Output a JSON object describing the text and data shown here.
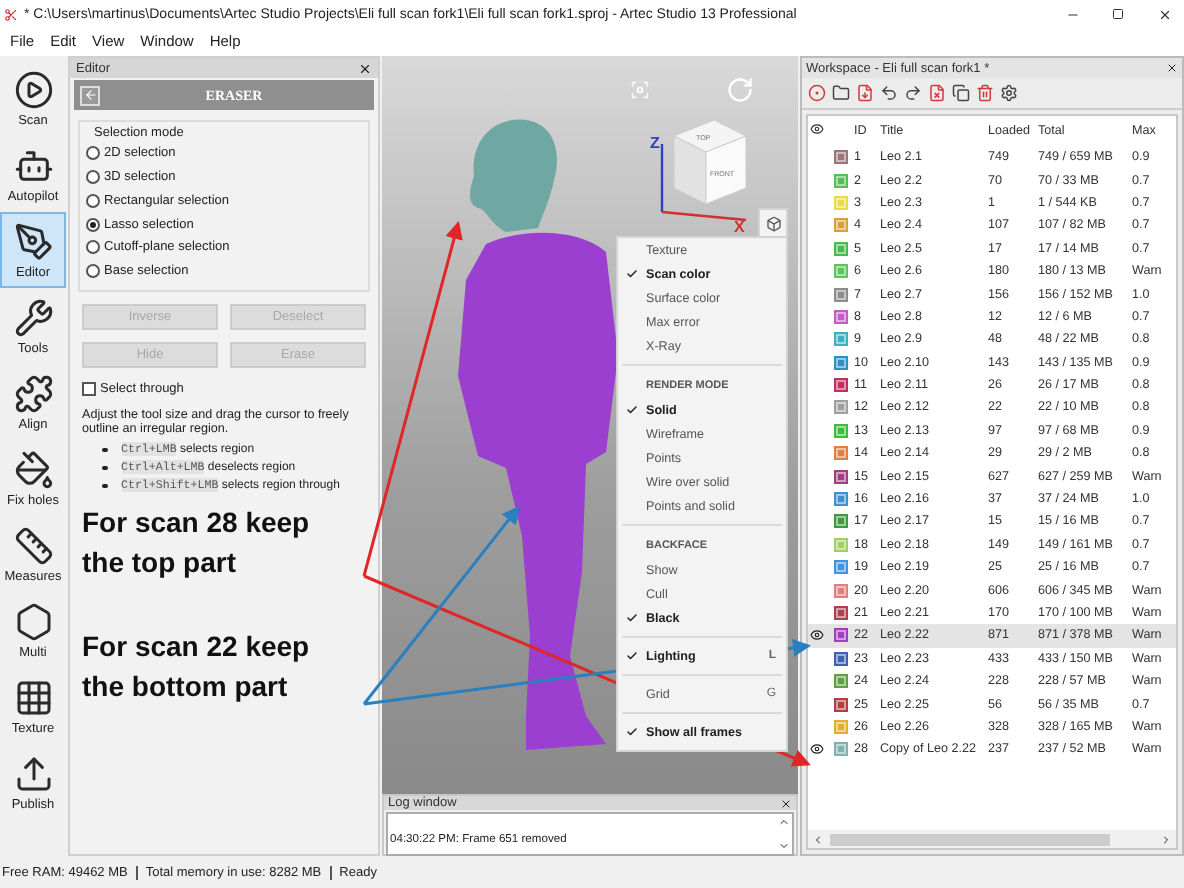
{
  "window": {
    "title": "* C:\\Users\\martinus\\Documents\\Artec Studio Projects\\Eli full scan fork1\\Eli full scan fork1.sproj - Artec Studio 13 Professional"
  },
  "menu": [
    "File",
    "Edit",
    "View",
    "Window",
    "Help"
  ],
  "toolbar": [
    {
      "label": "Scan",
      "selected": false
    },
    {
      "label": "Autopilot",
      "selected": false
    },
    {
      "label": "Editor",
      "selected": true
    },
    {
      "label": "Tools",
      "selected": false
    },
    {
      "label": "Align",
      "selected": false
    },
    {
      "label": "Fix holes",
      "selected": false
    },
    {
      "label": "Measures",
      "selected": false
    },
    {
      "label": "Multi",
      "selected": false
    },
    {
      "label": "Texture",
      "selected": false
    },
    {
      "label": "Publish",
      "selected": false
    }
  ],
  "editor": {
    "title": "Editor",
    "tool": "ERASER",
    "selection_mode": {
      "label": "Selection mode",
      "options": [
        {
          "label": "2D selection",
          "selected": false
        },
        {
          "label": "3D selection",
          "selected": false
        },
        {
          "label": "Rectangular selection",
          "selected": false
        },
        {
          "label": "Lasso selection",
          "selected": true
        },
        {
          "label": "Cutoff-plane selection",
          "selected": false
        },
        {
          "label": "Base selection",
          "selected": false
        }
      ]
    },
    "buttons": [
      {
        "label": "Inverse",
        "disabled": true
      },
      {
        "label": "Deselect",
        "disabled": true
      },
      {
        "label": "Hide",
        "disabled": true
      },
      {
        "label": "Erase",
        "disabled": true
      }
    ],
    "select_through": {
      "label": "Select through",
      "checked": false
    },
    "description": "Adjust the tool size and drag the cursor to freely outline an irregular region.",
    "shortcuts": [
      {
        "keys": "Ctrl+LMB",
        "text": "selects region"
      },
      {
        "keys": "Ctrl+Alt+LMB",
        "text": "deselects region"
      },
      {
        "keys": "Ctrl+Shift+LMB",
        "text": "selects region through"
      }
    ]
  },
  "annotations": [
    {
      "text": "For scan 28 keep the top part",
      "color": "#e02626"
    },
    {
      "text": "For scan 22 keep the bottom part",
      "color": "#2a7fc0"
    }
  ],
  "viewport": {
    "cube": {
      "top": "TOP",
      "front": "FRONT"
    },
    "axes": [
      "Z",
      "X"
    ],
    "render_menu": [
      {
        "kind": "item",
        "label": "Texture",
        "checked": false
      },
      {
        "kind": "item",
        "label": "Scan color",
        "checked": true
      },
      {
        "kind": "item",
        "label": "Surface color",
        "checked": false
      },
      {
        "kind": "item",
        "label": "Max error",
        "checked": false
      },
      {
        "kind": "item",
        "label": "X-Ray",
        "checked": false
      },
      {
        "kind": "separator"
      },
      {
        "kind": "header",
        "label": "RENDER MODE"
      },
      {
        "kind": "item",
        "label": "Solid",
        "checked": true
      },
      {
        "kind": "item",
        "label": "Wireframe",
        "checked": false
      },
      {
        "kind": "item",
        "label": "Points",
        "checked": false
      },
      {
        "kind": "item",
        "label": "Wire over solid",
        "checked": false
      },
      {
        "kind": "item",
        "label": "Points and solid",
        "checked": false
      },
      {
        "kind": "separator"
      },
      {
        "kind": "header",
        "label": "BACKFACE"
      },
      {
        "kind": "item",
        "label": "Show",
        "checked": false
      },
      {
        "kind": "item",
        "label": "Cull",
        "checked": false
      },
      {
        "kind": "item",
        "label": "Black",
        "checked": true
      },
      {
        "kind": "separator"
      },
      {
        "kind": "item",
        "label": "Lighting",
        "checked": true,
        "shortcut": "L"
      },
      {
        "kind": "separator"
      },
      {
        "kind": "item",
        "label": "Grid",
        "checked": false,
        "shortcut": "G"
      },
      {
        "kind": "separator"
      },
      {
        "kind": "item",
        "label": "Show all frames",
        "checked": true
      }
    ]
  },
  "log": {
    "title": "Log window",
    "entries": [
      "04:30:22 PM: Frame 651 removed"
    ]
  },
  "workspace": {
    "title": "Workspace - Eli full scan fork1 *",
    "columns": [
      "ID",
      "Title",
      "Loaded",
      "Total",
      "Max"
    ],
    "rows": [
      {
        "id": "1",
        "title": "Leo 2.1",
        "loaded": "749",
        "total": "749 / 659 MB",
        "max": "0.9",
        "color": "#9a7676",
        "visible": false,
        "selected": false
      },
      {
        "id": "2",
        "title": "Leo 2.2",
        "loaded": "70",
        "total": "70 / 33 MB",
        "max": "0.7",
        "color": "#52c052",
        "visible": false,
        "selected": false
      },
      {
        "id": "3",
        "title": "Leo 2.3",
        "loaded": "1",
        "total": "1 / 544 KB",
        "max": "0.7",
        "color": "#e6dc4a",
        "visible": false,
        "selected": false
      },
      {
        "id": "4",
        "title": "Leo 2.4",
        "loaded": "107",
        "total": "107 / 82 MB",
        "max": "0.7",
        "color": "#d8a040",
        "visible": false,
        "selected": false
      },
      {
        "id": "5",
        "title": "Leo 2.5",
        "loaded": "17",
        "total": "17 / 14 MB",
        "max": "0.7",
        "color": "#48bc48",
        "visible": false,
        "selected": false
      },
      {
        "id": "6",
        "title": "Leo 2.6",
        "loaded": "180",
        "total": "180 / 13 MB",
        "max": "Warn",
        "color": "#5cc45c",
        "visible": false,
        "selected": false
      },
      {
        "id": "7",
        "title": "Leo 2.7",
        "loaded": "156",
        "total": "156 / 152 MB",
        "max": "1.0",
        "color": "#8c8c8c",
        "visible": false,
        "selected": false
      },
      {
        "id": "8",
        "title": "Leo 2.8",
        "loaded": "12",
        "total": "12 / 6 MB",
        "max": "0.7",
        "color": "#c45cc4",
        "visible": false,
        "selected": false
      },
      {
        "id": "9",
        "title": "Leo 2.9",
        "loaded": "48",
        "total": "48 / 22 MB",
        "max": "0.8",
        "color": "#3eb0c0",
        "visible": false,
        "selected": false
      },
      {
        "id": "10",
        "title": "Leo 2.10",
        "loaded": "143",
        "total": "143 / 135 MB",
        "max": "0.9",
        "color": "#2e90c0",
        "visible": false,
        "selected": false
      },
      {
        "id": "11",
        "title": "Leo 2.11",
        "loaded": "26",
        "total": "26 / 17 MB",
        "max": "0.8",
        "color": "#c0305e",
        "visible": false,
        "selected": false
      },
      {
        "id": "12",
        "title": "Leo 2.12",
        "loaded": "22",
        "total": "22 / 10 MB",
        "max": "0.8",
        "color": "#a0a0a0",
        "visible": false,
        "selected": false
      },
      {
        "id": "13",
        "title": "Leo 2.13",
        "loaded": "97",
        "total": "97 / 68 MB",
        "max": "0.9",
        "color": "#3cbc3c",
        "visible": false,
        "selected": false
      },
      {
        "id": "14",
        "title": "Leo 2.14",
        "loaded": "29",
        "total": "29 / 2 MB",
        "max": "0.8",
        "color": "#e08040",
        "visible": false,
        "selected": false
      },
      {
        "id": "15",
        "title": "Leo 2.15",
        "loaded": "627",
        "total": "627 / 259 MB",
        "max": "Warn",
        "color": "#a04080",
        "visible": false,
        "selected": false
      },
      {
        "id": "16",
        "title": "Leo 2.16",
        "loaded": "37",
        "total": "37 / 24 MB",
        "max": "1.0",
        "color": "#4090d0",
        "visible": false,
        "selected": false
      },
      {
        "id": "17",
        "title": "Leo 2.17",
        "loaded": "15",
        "total": "15 / 16 MB",
        "max": "0.7",
        "color": "#3c9c3c",
        "visible": false,
        "selected": false
      },
      {
        "id": "18",
        "title": "Leo 2.18",
        "loaded": "149",
        "total": "149 / 161 MB",
        "max": "0.7",
        "color": "#a0d060",
        "visible": false,
        "selected": false
      },
      {
        "id": "19",
        "title": "Leo 2.19",
        "loaded": "25",
        "total": "25 / 16 MB",
        "max": "0.7",
        "color": "#4492e0",
        "visible": false,
        "selected": false
      },
      {
        "id": "20",
        "title": "Leo 2.20",
        "loaded": "606",
        "total": "606 / 345 MB",
        "max": "Warn",
        "color": "#e08080",
        "visible": false,
        "selected": false
      },
      {
        "id": "21",
        "title": "Leo 2.21",
        "loaded": "170",
        "total": "170 / 100 MB",
        "max": "Warn",
        "color": "#b04050",
        "visible": false,
        "selected": false
      },
      {
        "id": "22",
        "title": "Leo 2.22",
        "loaded": "871",
        "total": "871 / 378 MB",
        "max": "Warn",
        "color": "#a040c0",
        "visible": true,
        "selected": true
      },
      {
        "id": "23",
        "title": "Leo 2.23",
        "loaded": "433",
        "total": "433 / 150 MB",
        "max": "Warn",
        "color": "#4060b0",
        "visible": false,
        "selected": false
      },
      {
        "id": "24",
        "title": "Leo 2.24",
        "loaded": "228",
        "total": "228 / 57 MB",
        "max": "Warn",
        "color": "#60a040",
        "visible": false,
        "selected": false
      },
      {
        "id": "25",
        "title": "Leo 2.25",
        "loaded": "56",
        "total": "56 / 35 MB",
        "max": "0.7",
        "color": "#b04040",
        "visible": false,
        "selected": false
      },
      {
        "id": "26",
        "title": "Leo 2.26",
        "loaded": "328",
        "total": "328 / 165 MB",
        "max": "Warn",
        "color": "#e0b030",
        "visible": false,
        "selected": false
      },
      {
        "id": "28",
        "title": "Copy of Leo 2.22",
        "loaded": "237",
        "total": "237 / 52 MB",
        "max": "Warn",
        "color": "#80b0b0",
        "visible": true,
        "selected": false
      }
    ]
  },
  "status_bar": [
    "Free RAM: 49462 MB",
    "Total memory in use: 8282 MB",
    "Ready"
  ]
}
